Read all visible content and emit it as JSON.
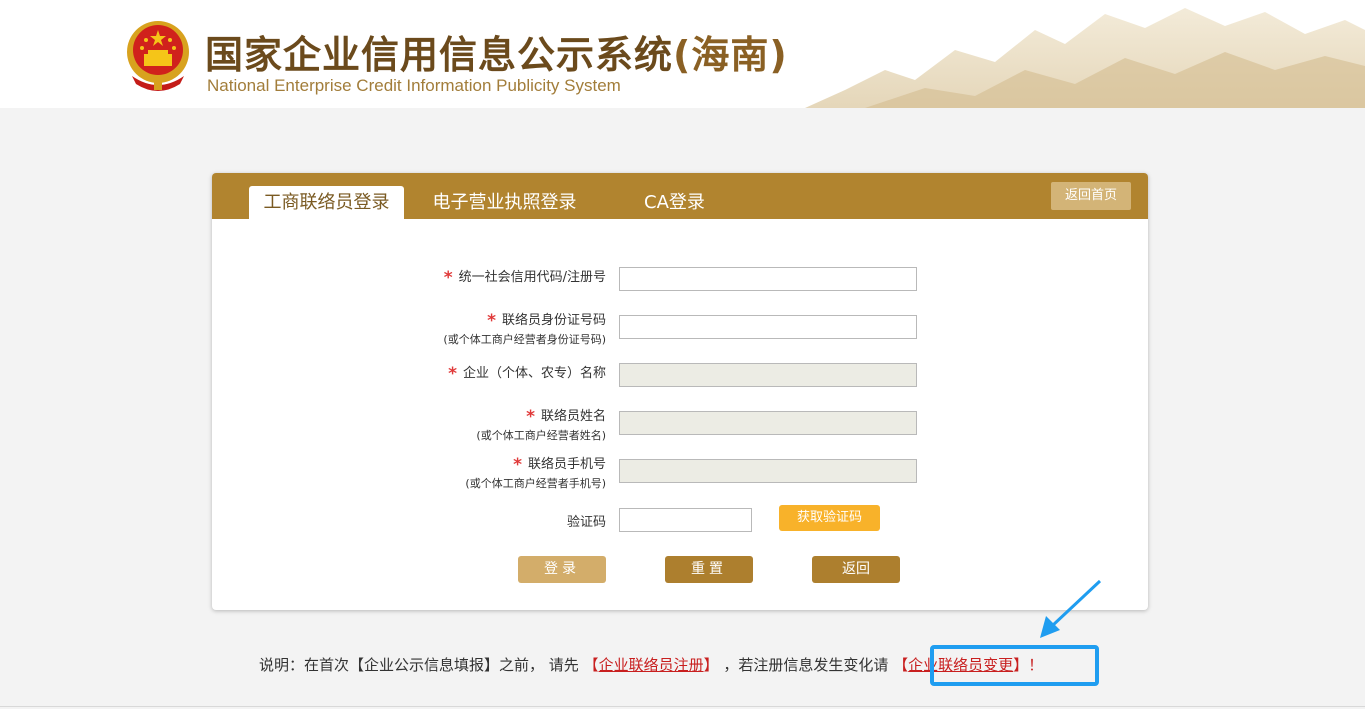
{
  "header": {
    "title_cn": "国家企业信用信息公示系统",
    "region": "(海南)",
    "title_en": "National Enterprise Credit Information Publicity System"
  },
  "tabs": [
    {
      "label": "工商联络员登录",
      "active": true
    },
    {
      "label": "电子营业执照登录",
      "active": false
    },
    {
      "label": "CA登录",
      "active": false
    }
  ],
  "home_button": "返回首页",
  "form": {
    "credit_code_label": "统一社会信用代码/注册号",
    "credit_code_value": "",
    "id_label": "联络员身份证号码",
    "id_sub": "(或个体工商户经营者身份证号码)",
    "id_value": "",
    "company_label": "企业（个体、农专）名称",
    "company_value": "",
    "name_label": "联络员姓名",
    "name_sub": "(或个体工商户经营者姓名)",
    "name_value": "",
    "phone_label": "联络员手机号",
    "phone_sub": "(或个体工商户经营者手机号)",
    "phone_value": "",
    "code_label": "验证码",
    "code_value": "",
    "get_code_button": "获取验证码",
    "required_mark": "*"
  },
  "buttons": {
    "login": "登录",
    "reset": "重置",
    "back": "返回"
  },
  "note": {
    "prefix": "说明：在首次【企业公示信息填报】之前，  请先 ",
    "reg_open": "【",
    "reg_link": "企业联络员注册",
    "reg_close": "】",
    "middle": "，若注册信息发生变化请 ",
    "chg_open": "【",
    "chg_link": "企业联络员变更",
    "chg_close": "】！"
  },
  "colors": {
    "brand_brown": "#b1842f",
    "accent_orange": "#f8b22a",
    "link_red": "#c81f1f",
    "highlight_blue": "#1f9df0"
  }
}
